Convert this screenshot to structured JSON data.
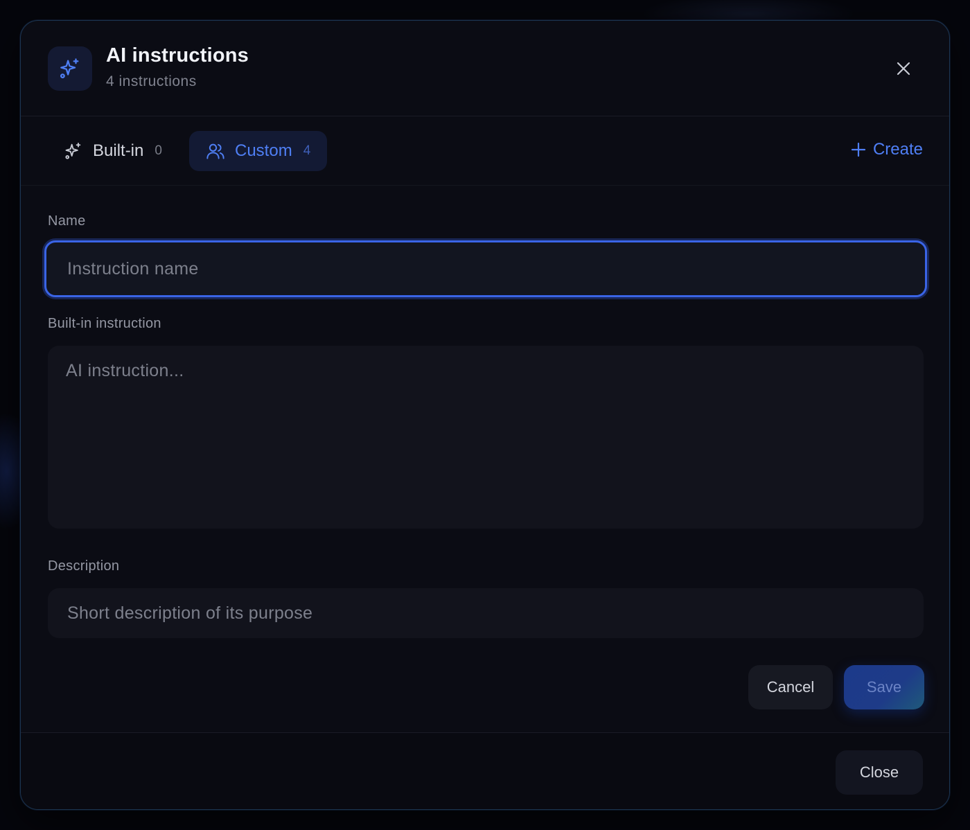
{
  "header": {
    "icon": "sparkles-icon",
    "title": "AI instructions",
    "subtitle": "4 instructions",
    "close_icon": "close-icon"
  },
  "tabs": [
    {
      "label": "Built-in",
      "count": "0",
      "icon": "sparkles-icon",
      "active": false
    },
    {
      "label": "Custom",
      "count": "4",
      "icon": "users-icon",
      "active": true
    }
  ],
  "create": {
    "label": "Create",
    "icon": "plus-icon"
  },
  "form": {
    "name": {
      "label": "Name",
      "value": "",
      "placeholder": "Instruction name"
    },
    "instruction": {
      "label": "Built-in instruction",
      "value": "",
      "placeholder": "AI instruction..."
    },
    "description": {
      "label": "Description",
      "value": "",
      "placeholder": "Short description of its purpose"
    },
    "cancel_label": "Cancel",
    "save_label": "Save"
  },
  "footer": {
    "close_label": "Close"
  },
  "colors": {
    "accent": "#4f7ff5",
    "background": "#0b0c14",
    "focus_ring": "#3a64e6"
  }
}
